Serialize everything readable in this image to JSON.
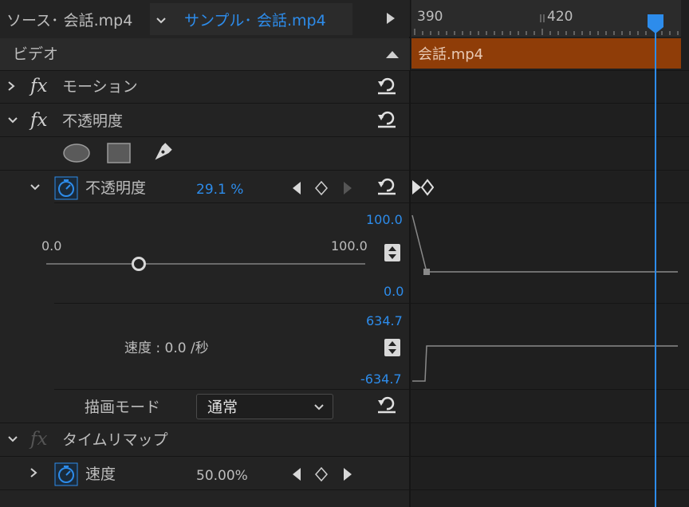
{
  "tabs": {
    "source_label": "ソース･ 会話.mp4",
    "sequence_label": "サンプル･ 会話.mp4"
  },
  "section": {
    "video_label": "ビデオ"
  },
  "timeline": {
    "ruler_label_1": "390",
    "ruler_label_2": "420",
    "clip_label": "会話.mp4"
  },
  "effects": {
    "motion_label": "モーション",
    "opacity_label": "不透明度",
    "opacity_param_label": "不透明度",
    "opacity_value": "29.1 %",
    "graph_max": "100.0",
    "graph_min": "0.0",
    "slider_min": "0.0",
    "slider_max": "100.0",
    "slider_level": 0.29,
    "velocity_max": "634.7",
    "velocity_min": "-634.7",
    "velocity_label": "速度 : 0.0 /秒",
    "blend_mode_label": "描画モード",
    "blend_mode_value": "通常",
    "time_remap_label": "タイムリマップ",
    "speed_label": "速度",
    "speed_value": "50.00%"
  },
  "colors": {
    "accent_blue": "#2d8ceb",
    "clip_orange": "#8f3d08",
    "panel_bg": "#232323"
  }
}
